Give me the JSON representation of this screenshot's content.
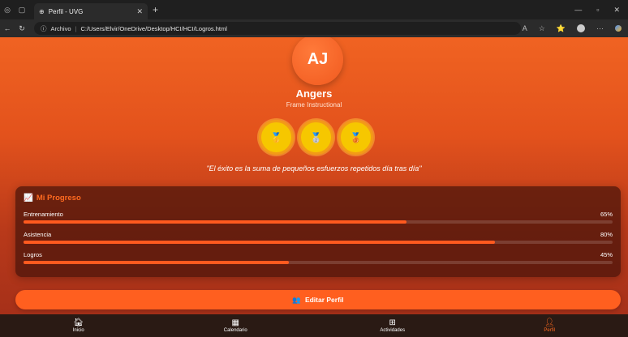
{
  "browser": {
    "tab_title": "Perfil - UVG",
    "address_prefix": "Archivo",
    "address_path": "C:/Users/Elvir/OneDrive/Desktop/HCI/HCI/Logros.html"
  },
  "profile": {
    "initials": "AJ",
    "name": "Angers",
    "role": "Frame Instructional",
    "quote": "\"El éxito es la suma de pequeños esfuerzos repetidos día tras día\""
  },
  "badges": [
    {
      "icon": "medal-gold-icon",
      "glyph": "🥇"
    },
    {
      "icon": "medal-silver-icon",
      "glyph": "🥈"
    },
    {
      "icon": "medal-bronze-icon",
      "glyph": "🥉"
    }
  ],
  "progress": {
    "title": "Mi Progreso",
    "items": [
      {
        "label": "Entrenamiento",
        "percent_text": "65%",
        "value": 65
      },
      {
        "label": "Asistencia",
        "percent_text": "80%",
        "value": 80
      },
      {
        "label": "Logros",
        "percent_text": "45%",
        "value": 45
      }
    ]
  },
  "edit_button": {
    "label": "Editar Perfil"
  },
  "bottom_nav": [
    {
      "label": "Inicio",
      "icon": "home-icon"
    },
    {
      "label": "Calendario",
      "icon": "calendar-icon"
    },
    {
      "label": "Actividades",
      "icon": "dumbbell-icon"
    },
    {
      "label": "Perfil",
      "icon": "user-icon"
    }
  ],
  "colors": {
    "accent": "#ff5f1f",
    "badge": "#f6c700"
  }
}
